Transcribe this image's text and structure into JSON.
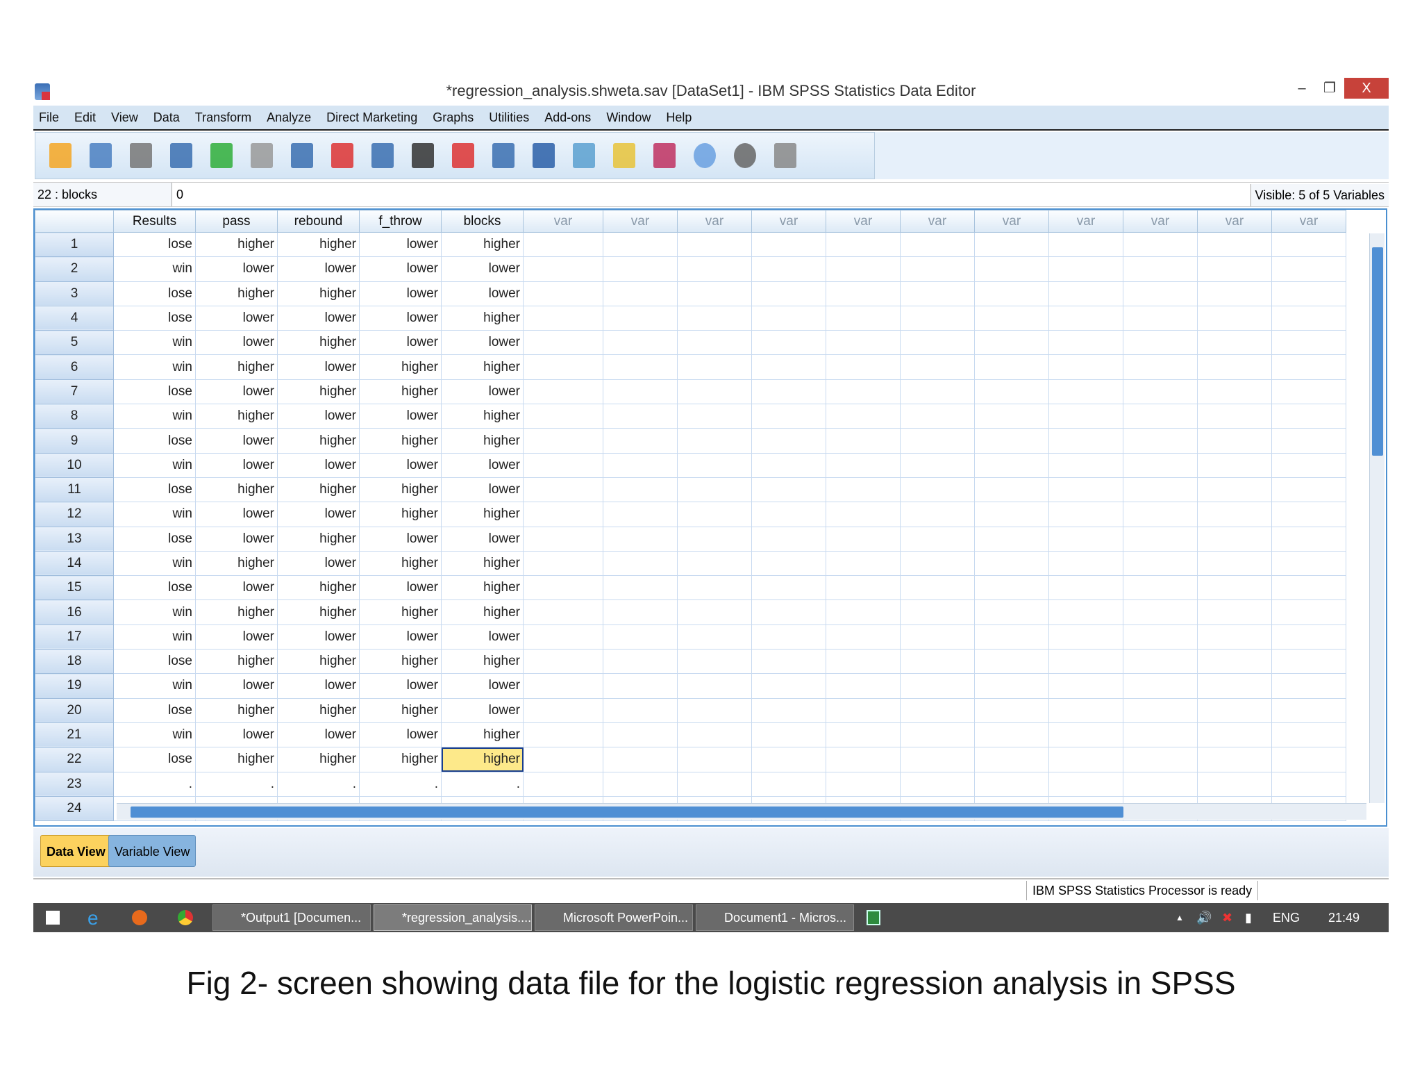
{
  "window": {
    "title": "*regression_analysis.shweta.sav [DataSet1] - IBM SPSS Statistics Data Editor",
    "minimize": "‒",
    "restore": "❐",
    "close": "X"
  },
  "menu": [
    "File",
    "Edit",
    "View",
    "Data",
    "Transform",
    "Analyze",
    "Direct Marketing",
    "Graphs",
    "Utilities",
    "Add-ons",
    "Window",
    "Help"
  ],
  "toolbar": [
    "open-icon",
    "save-icon",
    "print-icon",
    "recall-dialog-icon",
    "undo-icon",
    "redo-icon",
    "goto-case-icon",
    "goto-variable-icon",
    "variables-icon",
    "find-icon",
    "insert-cases-icon",
    "insert-variable-icon",
    "split-file-icon",
    "weight-cases-icon",
    "select-cases-icon",
    "value-labels-icon",
    "use-sets-icon",
    "show-all-variables-icon",
    "spell-check-icon"
  ],
  "cell_ref": "22 : blocks",
  "cell_value": "0",
  "visible": "Visible: 5 of 5 Variables",
  "columns": [
    "Results",
    "pass",
    "rebound",
    "f_throw",
    "blocks"
  ],
  "var_label": "var",
  "var_count": 11,
  "rows": [
    [
      "lose",
      "higher",
      "higher",
      "lower",
      "higher"
    ],
    [
      "win",
      "lower",
      "lower",
      "lower",
      "lower"
    ],
    [
      "lose",
      "higher",
      "higher",
      "lower",
      "lower"
    ],
    [
      "lose",
      "lower",
      "lower",
      "lower",
      "higher"
    ],
    [
      "win",
      "lower",
      "higher",
      "lower",
      "lower"
    ],
    [
      "win",
      "higher",
      "lower",
      "higher",
      "higher"
    ],
    [
      "lose",
      "lower",
      "higher",
      "higher",
      "lower"
    ],
    [
      "win",
      "higher",
      "lower",
      "lower",
      "higher"
    ],
    [
      "lose",
      "lower",
      "higher",
      "higher",
      "higher"
    ],
    [
      "win",
      "lower",
      "lower",
      "lower",
      "lower"
    ],
    [
      "lose",
      "higher",
      "higher",
      "higher",
      "lower"
    ],
    [
      "win",
      "lower",
      "lower",
      "higher",
      "higher"
    ],
    [
      "lose",
      "lower",
      "higher",
      "lower",
      "lower"
    ],
    [
      "win",
      "higher",
      "lower",
      "higher",
      "higher"
    ],
    [
      "lose",
      "lower",
      "higher",
      "lower",
      "higher"
    ],
    [
      "win",
      "higher",
      "higher",
      "higher",
      "higher"
    ],
    [
      "win",
      "lower",
      "lower",
      "lower",
      "lower"
    ],
    [
      "lose",
      "higher",
      "higher",
      "higher",
      "higher"
    ],
    [
      "win",
      "lower",
      "lower",
      "lower",
      "lower"
    ],
    [
      "lose",
      "higher",
      "higher",
      "higher",
      "lower"
    ],
    [
      "win",
      "lower",
      "lower",
      "lower",
      "higher"
    ],
    [
      "lose",
      "higher",
      "higher",
      "higher",
      "higher"
    ],
    [
      ".",
      ".",
      ".",
      ".",
      "."
    ],
    [
      "",
      "",
      "",
      "",
      ""
    ]
  ],
  "selected": {
    "row": 22,
    "col": "blocks"
  },
  "tabs": {
    "data_view": "Data View",
    "variable_view": "Variable View"
  },
  "status": "IBM SPSS Statistics Processor is ready",
  "taskbar": {
    "items": [
      "*Output1 [Documen...",
      "*regression_analysis....",
      "Microsoft PowerPoin...",
      "Document1 - Micros..."
    ],
    "lang": "ENG",
    "time": "21:49"
  },
  "caption": "Fig 2- screen showing data file for the logistic regression analysis in SPSS"
}
